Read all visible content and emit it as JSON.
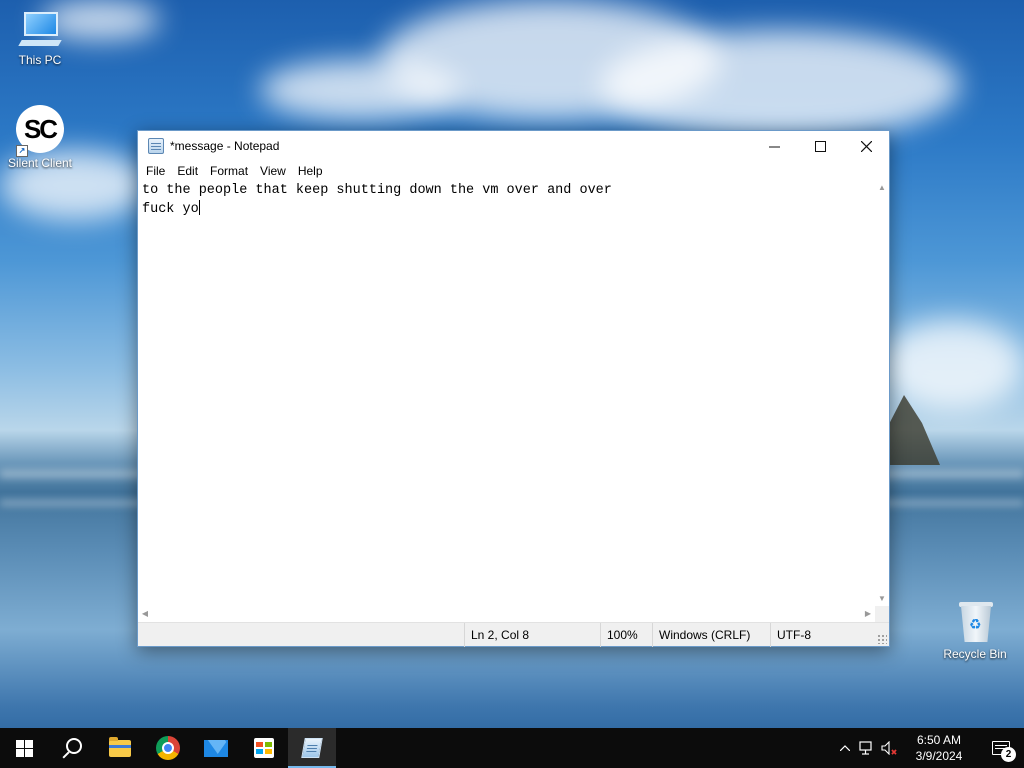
{
  "desktop": {
    "icons": [
      {
        "label": "This PC"
      },
      {
        "label": "Silent Client",
        "glyph_text": "SC"
      },
      {
        "label": "Recycle Bin"
      }
    ]
  },
  "notepad": {
    "title": "*message - Notepad",
    "menu": [
      "File",
      "Edit",
      "Format",
      "View",
      "Help"
    ],
    "content": {
      "line1": "to the people that keep shutting down the vm over and over",
      "line2": "fuck yo"
    },
    "status": {
      "position": "Ln 2, Col 8",
      "zoom": "100%",
      "line_ending": "Windows (CRLF)",
      "encoding": "UTF-8"
    }
  },
  "taskbar": {
    "pinned": [
      "start-icon",
      "search-icon",
      "file-explorer-icon",
      "chrome-icon",
      "mail-icon",
      "store-icon",
      "notepad-icon"
    ],
    "clock": {
      "time": "6:50 AM",
      "date": "3/9/2024"
    },
    "notification_count": "2",
    "accent": "#76b9ed"
  }
}
